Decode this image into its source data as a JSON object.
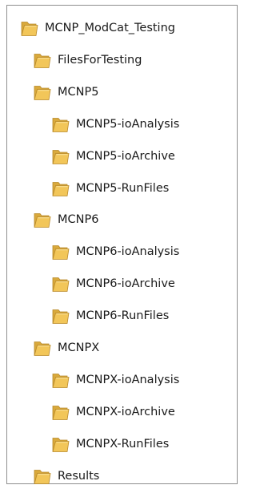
{
  "colors": {
    "folder_body": "#F2C659",
    "folder_back": "#D9A93C",
    "folder_outline": "#B8892A",
    "folder_highlight": "#F8DE93",
    "border": "#8F8F8F",
    "text": "#1A1A1A"
  },
  "tree": {
    "icon": "folder-icon",
    "items": [
      {
        "label": "MCNP_ModCat_Testing"
      },
      {
        "label": "FilesForTesting"
      },
      {
        "label": "MCNP5"
      },
      {
        "label": "MCNP5-ioAnalysis"
      },
      {
        "label": "MCNP5-ioArchive"
      },
      {
        "label": "MCNP5-RunFiles"
      },
      {
        "label": "MCNP6"
      },
      {
        "label": "MCNP6-ioAnalysis"
      },
      {
        "label": "MCNP6-ioArchive"
      },
      {
        "label": "MCNP6-RunFiles"
      },
      {
        "label": "MCNPX"
      },
      {
        "label": "MCNPX-ioAnalysis"
      },
      {
        "label": "MCNPX-ioArchive"
      },
      {
        "label": "MCNPX-RunFiles"
      },
      {
        "label": "Results"
      }
    ]
  }
}
